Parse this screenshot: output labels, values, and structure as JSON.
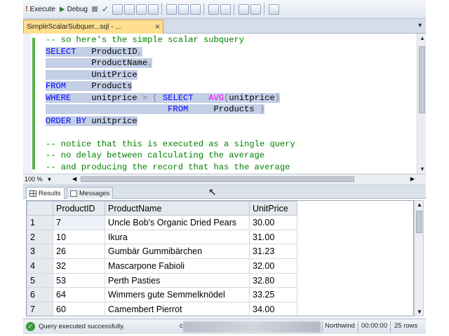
{
  "toolbar": {
    "execute_label": "Execute",
    "debug_label": "Debug"
  },
  "document_tab": {
    "title": "SimpleScalarSubquer...sql - ...",
    "close": "×"
  },
  "editor": {
    "lines": [
      {
        "parts": [
          {
            "t": "-- so here's the simple scalar subquery",
            "c": "cm"
          }
        ],
        "sel": false
      },
      {
        "parts": [
          {
            "t": "SELECT",
            "c": "kw"
          },
          {
            "t": "   ProductID",
            "c": "pl"
          },
          {
            "t": ",",
            "c": "op"
          }
        ],
        "sel": true
      },
      {
        "parts": [
          {
            "t": "         ProductName",
            "c": "pl"
          },
          {
            "t": ",",
            "c": "op"
          }
        ],
        "sel": true
      },
      {
        "parts": [
          {
            "t": "         UnitPrice",
            "c": "pl"
          }
        ],
        "sel": true
      },
      {
        "parts": [
          {
            "t": "FROM",
            "c": "kw"
          },
          {
            "t": "     Products",
            "c": "pl"
          }
        ],
        "sel": true
      },
      {
        "parts": [
          {
            "t": "WHERE",
            "c": "kw"
          },
          {
            "t": "    unitprice ",
            "c": "pl"
          },
          {
            "t": "> (",
            "c": "op"
          },
          {
            "t": " SELECT",
            "c": "kw"
          },
          {
            "t": "   ",
            "c": "pl"
          },
          {
            "t": "AVG",
            "c": "fn"
          },
          {
            "t": "(",
            "c": "op"
          },
          {
            "t": "unitprice",
            "c": "pl"
          },
          {
            "t": ")",
            "c": "op"
          }
        ],
        "sel": true
      },
      {
        "parts": [
          {
            "t": "                        FROM",
            "c": "kw"
          },
          {
            "t": "     Products ",
            "c": "pl"
          },
          {
            "t": ")",
            "c": "op"
          }
        ],
        "sel": true
      },
      {
        "parts": [
          {
            "t": "ORDER BY",
            "c": "kw"
          },
          {
            "t": " unitprice",
            "c": "pl"
          }
        ],
        "sel": true
      },
      {
        "parts": [
          {
            "t": "",
            "c": "pl"
          }
        ],
        "sel": false
      },
      {
        "parts": [
          {
            "t": "-- notice that this is executed as a single query",
            "c": "cm"
          }
        ],
        "sel": false
      },
      {
        "parts": [
          {
            "t": "-- no delay between calculating the average",
            "c": "cm"
          }
        ],
        "sel": false
      },
      {
        "parts": [
          {
            "t": "-- and producing the record that has the average",
            "c": "cm"
          }
        ],
        "sel": false
      }
    ]
  },
  "zoom": {
    "value": "100 %"
  },
  "result_tabs": {
    "results": "Results",
    "messages": "Messages"
  },
  "grid": {
    "columns": [
      "",
      "ProductID",
      "ProductName",
      "UnitPrice"
    ],
    "rows": [
      [
        "1",
        "7",
        "Uncle Bob's Organic Dried Pears",
        "30.00"
      ],
      [
        "2",
        "10",
        "Ikura",
        "31.00"
      ],
      [
        "3",
        "26",
        "Gumbär Gummibärchen",
        "31.23"
      ],
      [
        "4",
        "32",
        "Mascarpone Fabioli",
        "32.00"
      ],
      [
        "5",
        "53",
        "Perth Pasties",
        "32.80"
      ],
      [
        "6",
        "64",
        "Wimmers gute Semmelknödel",
        "33.25"
      ],
      [
        "7",
        "60",
        "Camembert Pierrot",
        "34.00"
      ]
    ]
  },
  "status": {
    "message": "Query executed successfully.",
    "partial_char": "c",
    "database": "Northwind",
    "elapsed": "00:00:00",
    "rows": "25 rows"
  },
  "icons": {
    "execute": "execute-icon",
    "debug": "debug-icon",
    "success": "check-circle-icon"
  },
  "colors": {
    "keyword": "#0000ff",
    "comment": "#008000",
    "function": "#ff00ff",
    "selection": "#c3cfe6",
    "doc_tab": "#ffdf8f"
  }
}
